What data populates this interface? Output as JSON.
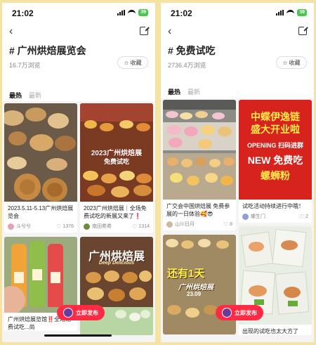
{
  "left": {
    "status": {
      "time": "21:02",
      "battery": "39"
    },
    "title": "# 广州烘焙展览会",
    "views": "16.7万浏览",
    "collect_label": "收藏",
    "tabs": {
      "hot": "最热",
      "new": "最新"
    },
    "cards": [
      {
        "title": "2023.5.11-5.13广州烘焙展览会",
        "user": "斗兮兮",
        "likes": "1376"
      },
      {
        "title": "2023广州烘焙展｜全场免费试吃的新展又来了❗",
        "user": "南田希希",
        "likes": "1314",
        "overlay": "2023广州烘焙展",
        "overlay_sub": "免费试吃"
      },
      {
        "title": "广州烘焙展览馆‼️全场免费试吃...尚",
        "user": "",
        "likes": ""
      },
      {
        "title": "",
        "user": "",
        "likes": "",
        "overlay": "广州烘焙展",
        "overlay_sub": "Deep Delicious"
      }
    ],
    "post_label": "立即发布"
  },
  "right": {
    "status": {
      "time": "21:02",
      "battery": "39"
    },
    "title": "# 免费试吃",
    "views": "2736.4万浏览",
    "collect_label": "收藏",
    "tabs": {
      "hot": "最热",
      "new": "最新"
    },
    "cards": [
      {
        "title": "广交会中国烘焙展 免费参展的一日体验🥰😎",
        "user": "山川日月",
        "likes": "8"
      },
      {
        "title": "试吃活动持续进行中哦！",
        "user": "螺生门",
        "likes": "2",
        "overlay_lines": [
          "中蝶伊逸链",
          "盛大开业啦",
          "OPENING 扫码进群",
          "NEW 免费吃",
          "螺蛳粉"
        ]
      },
      {
        "title": "",
        "user": "",
        "likes": "",
        "overlay": "还有1天",
        "overlay_sub": "广州烘焙展",
        "overlay_date": "23.09"
      },
      {
        "title": "出现的试吃也太大方了",
        "user": "",
        "likes": ""
      }
    ],
    "post_label": "立即发布"
  },
  "colors": {
    "accent": "#ff2b44",
    "battery": "#46c84a",
    "frame": "#f4e3a3"
  }
}
